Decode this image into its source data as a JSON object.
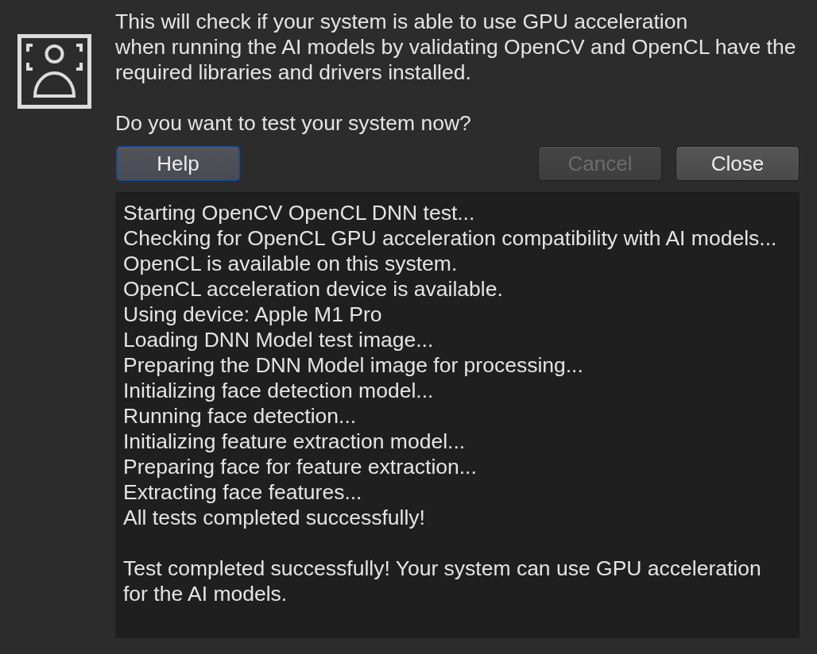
{
  "message": {
    "description": "This will check if your system is able to use GPU acceleration\nwhen running the AI models by validating OpenCV and OpenCL have the required libraries and drivers installed.",
    "question": "Do you want to test your system now?"
  },
  "buttons": [
    {
      "label": "Help",
      "kind": "help",
      "focused": true,
      "disabled": false
    },
    {
      "label": "Cancel",
      "kind": "cancel",
      "focused": false,
      "disabled": true
    },
    {
      "label": "Close",
      "kind": "close",
      "focused": false,
      "disabled": false
    }
  ],
  "log": {
    "lines": [
      "Starting OpenCV OpenCL DNN test...",
      "Checking for OpenCL GPU acceleration compatibility with AI models...",
      "OpenCL is available on this system.",
      "OpenCL acceleration device is available.",
      "Using device: Apple M1 Pro",
      "Loading DNN Model test image...",
      "Preparing the DNN Model image for processing...",
      "Initializing face detection model...",
      "Running face detection...",
      "Initializing feature extraction model...",
      "Preparing face for feature extraction...",
      "Extracting face features...",
      "All tests completed successfully!"
    ],
    "result": "Test completed successfully! Your system can use GPU acceleration for the AI models."
  }
}
